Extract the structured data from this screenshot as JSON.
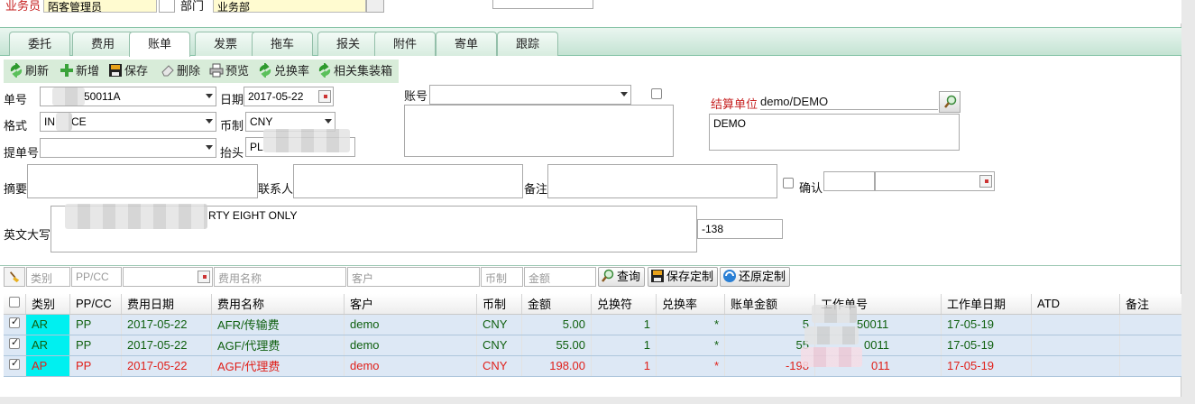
{
  "top": {
    "salesman_label": "业务员",
    "salesman_value": "陌客管理员",
    "dept_label": "部门",
    "dept_value": "业务部"
  },
  "tabs": [
    "委托",
    "费用",
    "账单",
    "发票",
    "拖车",
    "报关",
    "附件",
    "寄单",
    "跟踪"
  ],
  "active_tab": 2,
  "toolbar": [
    {
      "label": "刷新",
      "icon": "refresh-icon"
    },
    {
      "label": "新增",
      "icon": "plus-icon"
    },
    {
      "label": "保存",
      "icon": "save-icon"
    },
    {
      "label": "删除",
      "icon": "eraser-icon"
    },
    {
      "label": "预览",
      "icon": "printer-icon"
    },
    {
      "label": "兑换率",
      "icon": "refresh-icon"
    },
    {
      "label": "相关集装箱",
      "icon": "refresh-icon"
    }
  ],
  "form": {
    "bill_no_label": "单号",
    "bill_no_value": "50011A",
    "date_label": "日期",
    "date_value": "2017-05-22",
    "account_label": "账号",
    "account_value": "",
    "settle_label": "结算单位",
    "settle_value": "demo/DEMO",
    "settle_text": "DEMO",
    "format_label": "格式",
    "format_value": "IN",
    "format_value_tail": "CE",
    "currency_label": "币制",
    "currency_value": "CNY",
    "bl_label": "提单号",
    "bl_value": "",
    "header_label": "抬头",
    "header_value": "PL",
    "summary_label": "摘要",
    "contact_label": "联系人",
    "remark_label": "备注",
    "confirm_label": "确认",
    "english_label": "英文大写",
    "english_value": "RTY EIGHT ONLY",
    "total_value": "-138"
  },
  "filter": {
    "type_ph": "类别",
    "ppcc_ph": "PP/CC",
    "fee_name_ph": "费用名称",
    "customer_ph": "客户",
    "currency_ph": "币制",
    "amount_ph": "金额",
    "query_label": "查询",
    "save_custom_label": "保存定制",
    "restore_custom_label": "还原定制"
  },
  "grid": {
    "headers": [
      "类别",
      "PP/CC",
      "费用日期",
      "费用名称",
      "客户",
      "币制",
      "金额",
      "兑换符",
      "兑换率",
      "账单金额",
      "工作单号",
      "工作单日期",
      "ATD",
      "备注"
    ],
    "rows": [
      {
        "type": "AR",
        "ppcc": "PP",
        "date": "2017-05-22",
        "name": "AFR/传输费",
        "customer": "demo",
        "currency": "CNY",
        "amount": "5.00",
        "op": "1",
        "rate": "*",
        "bill_amount": "5",
        "job_no": "50011",
        "job_date": "17-05-19",
        "atd": "",
        "remark": "",
        "checked": true
      },
      {
        "type": "AR",
        "ppcc": "PP",
        "date": "2017-05-22",
        "name": "AGF/代理费",
        "customer": "demo",
        "currency": "CNY",
        "amount": "55.00",
        "op": "1",
        "rate": "*",
        "bill_amount": "55",
        "job_no": "0011",
        "job_date": "17-05-19",
        "atd": "",
        "remark": "",
        "checked": true
      },
      {
        "type": "AP",
        "ppcc": "PP",
        "date": "2017-05-22",
        "name": "AGF/代理费",
        "customer": "demo",
        "currency": "CNY",
        "amount": "198.00",
        "op": "1",
        "rate": "*",
        "bill_amount": "-198",
        "job_no": "011",
        "job_date": "17-05-19",
        "atd": "",
        "remark": "",
        "checked": true
      }
    ]
  },
  "colors": {
    "accent": "#d8ecd9",
    "ar_text": "#106010",
    "ap_text": "#e0201a",
    "type_bg": "#00f0f0",
    "row_bg": "#dde8f5"
  }
}
